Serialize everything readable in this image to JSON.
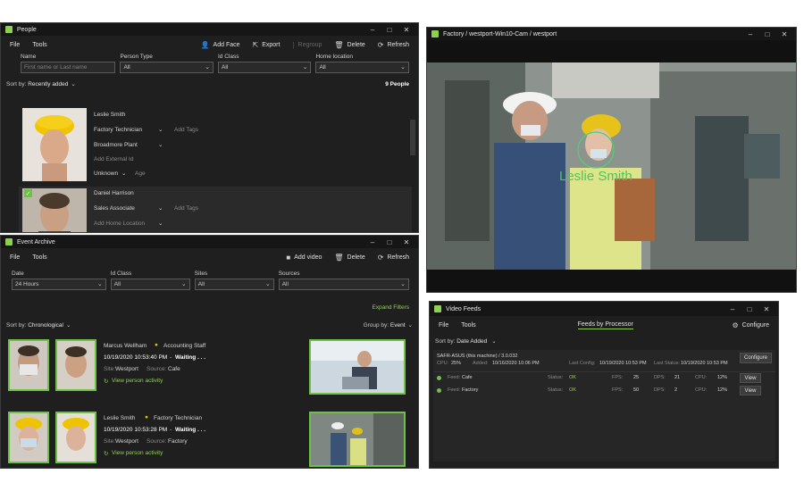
{
  "people": {
    "title": "People",
    "menu": [
      "File",
      "Tools"
    ],
    "toolbar": {
      "add_face": "Add Face",
      "export": "Export",
      "regroup": "Regroup",
      "delete": "Delete",
      "refresh": "Refresh"
    },
    "filters": {
      "name_label": "Name",
      "name_placeholder": "First name or Last name",
      "person_type_label": "Person Type",
      "person_type_value": "All",
      "id_class_label": "Id Class",
      "id_class_value": "All",
      "home_location_label": "Home location",
      "home_location_value": "All"
    },
    "sort_prefix": "Sort by:",
    "sort_value": "Recently added",
    "count": "9 People",
    "cards": [
      {
        "name": "Leslie Smith",
        "role": "Factory Technician",
        "add_tags": "Add Tags",
        "site": "Broadmore Plant",
        "external_id": "Add External Id",
        "gender": "Unknown",
        "age": "Age"
      },
      {
        "name": "Daniel Harrison",
        "role": "Sales Associate",
        "add_tags": "Add Tags",
        "home_location": "Add Home Location"
      }
    ]
  },
  "factory": {
    "title": "Factory / westport-Win10-Cam / westport",
    "overlay_name": "Leslie Smith"
  },
  "events": {
    "title": "Event Archive",
    "menu": [
      "File",
      "Tools"
    ],
    "toolbar": {
      "add_video": "Add video",
      "delete": "Delete",
      "refresh": "Refresh"
    },
    "filters": {
      "date_label": "Date",
      "date_value": "24 Hours",
      "id_class_label": "Id Class",
      "id_class_value": "All",
      "sites_label": "Sites",
      "sites_value": "All",
      "sources_label": "Sources",
      "sources_value": "All"
    },
    "expand_filters": "Expand Filters",
    "sort_prefix": "Sort by:",
    "sort_value": "Chronological",
    "group_prefix": "Group by:",
    "group_value": "Event",
    "items": [
      {
        "name": "Marcus Wellham",
        "class": "Accounting Staff",
        "time": "10/19/2020 10:53:40 PM",
        "status": "Waiting . . .",
        "site_label": "Site:",
        "site": "Westport",
        "source_label": "Source:",
        "source": "Cafe",
        "link": "View person activity"
      },
      {
        "name": "Leslie Smith",
        "class": "Factory Technician",
        "time": "10/19/2020 10:53:28 PM",
        "status": "Waiting . . .",
        "site_label": "Site:",
        "site": "Westport",
        "source_label": "Source:",
        "source": "Factory",
        "link": "View person activity"
      }
    ]
  },
  "feeds": {
    "title": "Video Feeds",
    "menu": [
      "File",
      "Tools"
    ],
    "tab": "Feeds by Processor",
    "configure": "Configure",
    "sort_prefix": "Sort by:",
    "sort_value": "Date Added",
    "processor": {
      "name": "SAFR-ASUS (this machine) / 3.0.032",
      "cpu_label": "CPU:",
      "cpu": "25%",
      "added_label": "Added:",
      "added": "10/16/2020 10:06 PM",
      "last_config_label": "Last Config:",
      "last_config": "10/19/2020 10:53 PM",
      "last_status_label": "Last Status:",
      "last_status": "10/19/2020 10:53 PM",
      "configure_btn": "Configure"
    },
    "rows": [
      {
        "feed_label": "Feed:",
        "feed": "Cafe",
        "status_label": "Status:",
        "status": "OK",
        "fps_label": "FPS:",
        "fps": "25",
        "dps_label": "DPS:",
        "dps": "21",
        "cpu_label": "CPU:",
        "cpu": "12%",
        "view": "View"
      },
      {
        "feed_label": "Feed:",
        "feed": "Factory",
        "status_label": "Status:",
        "status": "OK",
        "fps_label": "FPS:",
        "fps": "50",
        "dps_label": "DPS:",
        "dps": "2",
        "cpu_label": "CPU:",
        "cpu": "12%",
        "view": "View"
      }
    ]
  },
  "colors": {
    "accent": "#8fd14f",
    "window_bg": "#1f1f1f",
    "titlebar": "#161616"
  }
}
